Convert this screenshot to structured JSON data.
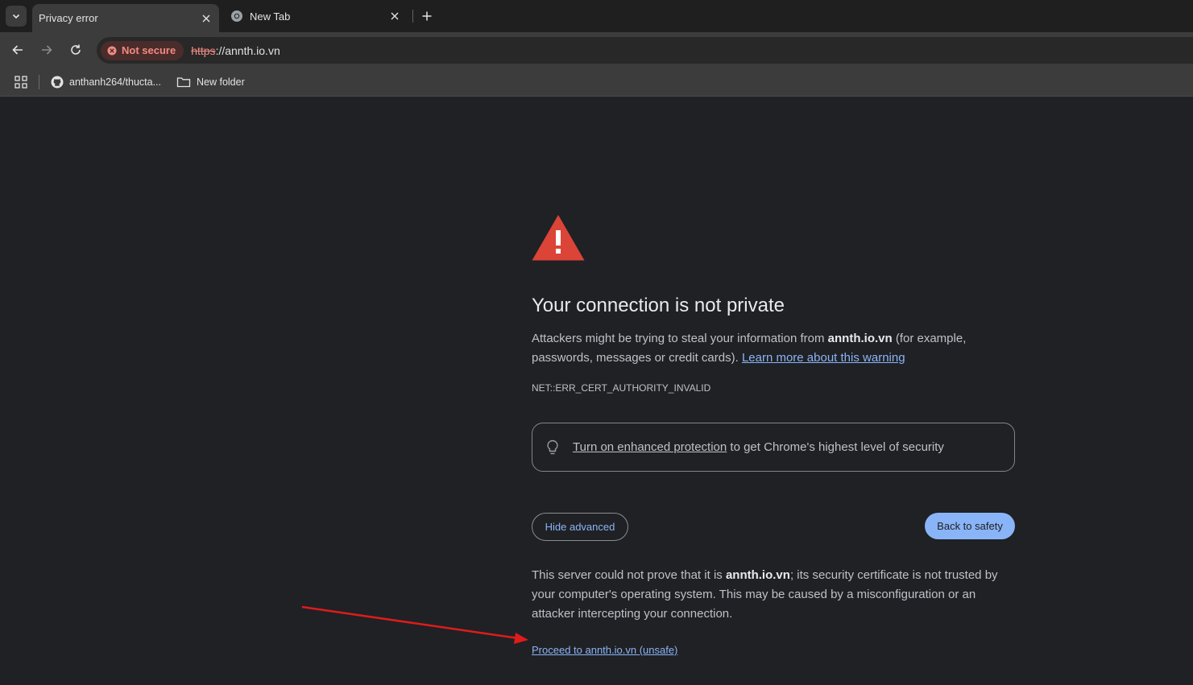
{
  "tabs": [
    {
      "label": "Privacy error",
      "active": true,
      "icon": "none"
    },
    {
      "label": "New Tab",
      "active": false,
      "icon": "chrome-icon"
    }
  ],
  "toolbar": {
    "security_chip": "Not secure",
    "url_scheme": "https",
    "url_rest": "://annth.io.vn"
  },
  "bookmarks": [
    {
      "label": "anthanh264/thucta...",
      "icon": "github-icon"
    },
    {
      "label": "New folder",
      "icon": "folder-icon"
    }
  ],
  "interstitial": {
    "heading": "Your connection is not private",
    "msg_before": "Attackers might be trying to steal your information from ",
    "msg_domain": "annth.io.vn",
    "msg_after": " (for example, passwords, messages or credit cards). ",
    "learn_more": "Learn more about this warning",
    "error_code": "NET::ERR_CERT_AUTHORITY_INVALID",
    "enhanced_link": "Turn on enhanced protection",
    "enhanced_rest": " to get Chrome's highest level of security",
    "hide_advanced": "Hide advanced",
    "back_to_safety": "Back to safety",
    "details_before": "This server could not prove that it is ",
    "details_domain": "annth.io.vn",
    "details_after": "; its security certificate is not trusted by your computer's operating system. This may be caused by a misconfiguration or an attacker intercepting your connection.",
    "proceed": "Proceed to annth.io.vn (unsafe)"
  },
  "colors": {
    "background": "#202124",
    "link": "#8ab4f8",
    "warning": "#db4437",
    "annotation_arrow": "#e01b1b"
  }
}
